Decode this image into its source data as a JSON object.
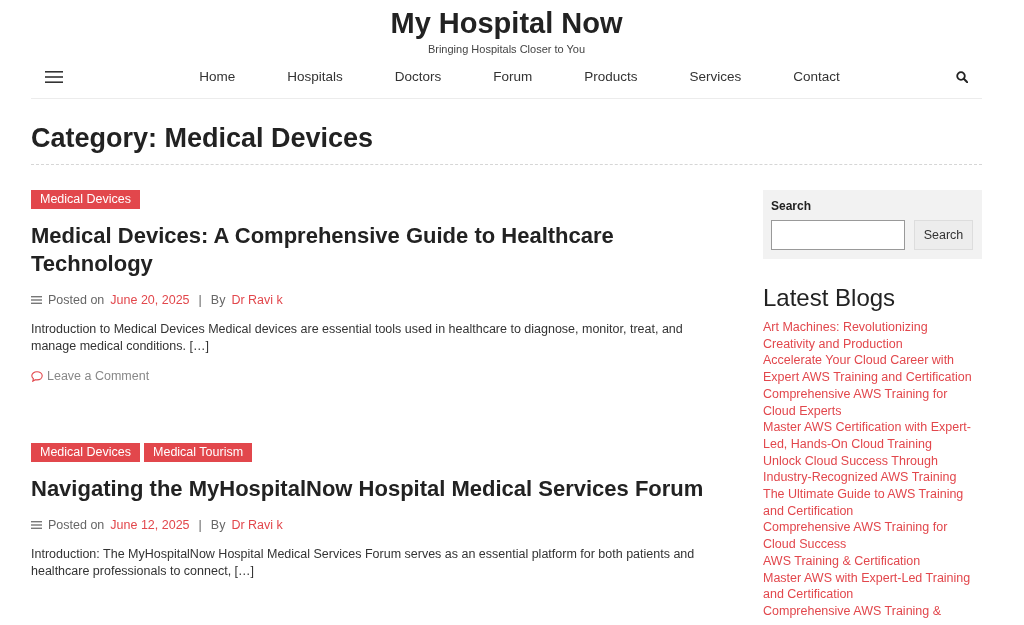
{
  "site": {
    "title": "My Hospital Now",
    "tagline": "Bringing Hospitals Closer to You"
  },
  "nav": {
    "items": [
      {
        "label": "Home"
      },
      {
        "label": "Hospitals"
      },
      {
        "label": "Doctors"
      },
      {
        "label": "Forum"
      },
      {
        "label": "Products"
      },
      {
        "label": "Services"
      },
      {
        "label": "Contact"
      }
    ]
  },
  "page_title": "Category: Medical Devices",
  "posts": [
    {
      "categories": [
        "Medical Devices"
      ],
      "title": "Medical Devices: A Comprehensive Guide to Healthcare Technology",
      "posted_label": "Posted on",
      "date": "June 20, 2025",
      "separator": "|",
      "by_label": "By",
      "author": "Dr Ravi k",
      "excerpt": "Introduction to Medical Devices Medical devices are essential tools used in healthcare to diagnose, monitor, treat, and manage medical conditions. […]",
      "comment_link": "Leave a Comment"
    },
    {
      "categories": [
        "Medical Devices",
        "Medical Tourism"
      ],
      "title": "Navigating the MyHospitalNow Hospital Medical Services Forum",
      "posted_label": "Posted on",
      "date": "June 12, 2025",
      "separator": "|",
      "by_label": "By",
      "author": "Dr Ravi k",
      "excerpt": "Introduction: The MyHospitalNow Hospital Medical Services Forum serves as an essential platform for both patients and healthcare professionals to connect, […]"
    }
  ],
  "sidebar": {
    "search": {
      "label": "Search",
      "button": "Search"
    },
    "latest_blogs": {
      "title": "Latest Blogs",
      "items": [
        "Art Machines: Revolutionizing Creativity and Production",
        "Accelerate Your Cloud Career with Expert AWS Training and Certification",
        "Comprehensive AWS Training for Cloud Experts",
        "Master AWS Certification with Expert-Led, Hands-On Cloud Training",
        "Unlock Cloud Success Through Industry-Recognized AWS Training",
        "The Ultimate Guide to AWS Training and Certification",
        "Comprehensive AWS Training for Cloud Success",
        "AWS Training & Certification",
        "Master AWS with Expert-Led Training and Certification",
        "Comprehensive AWS Training &"
      ]
    }
  }
}
